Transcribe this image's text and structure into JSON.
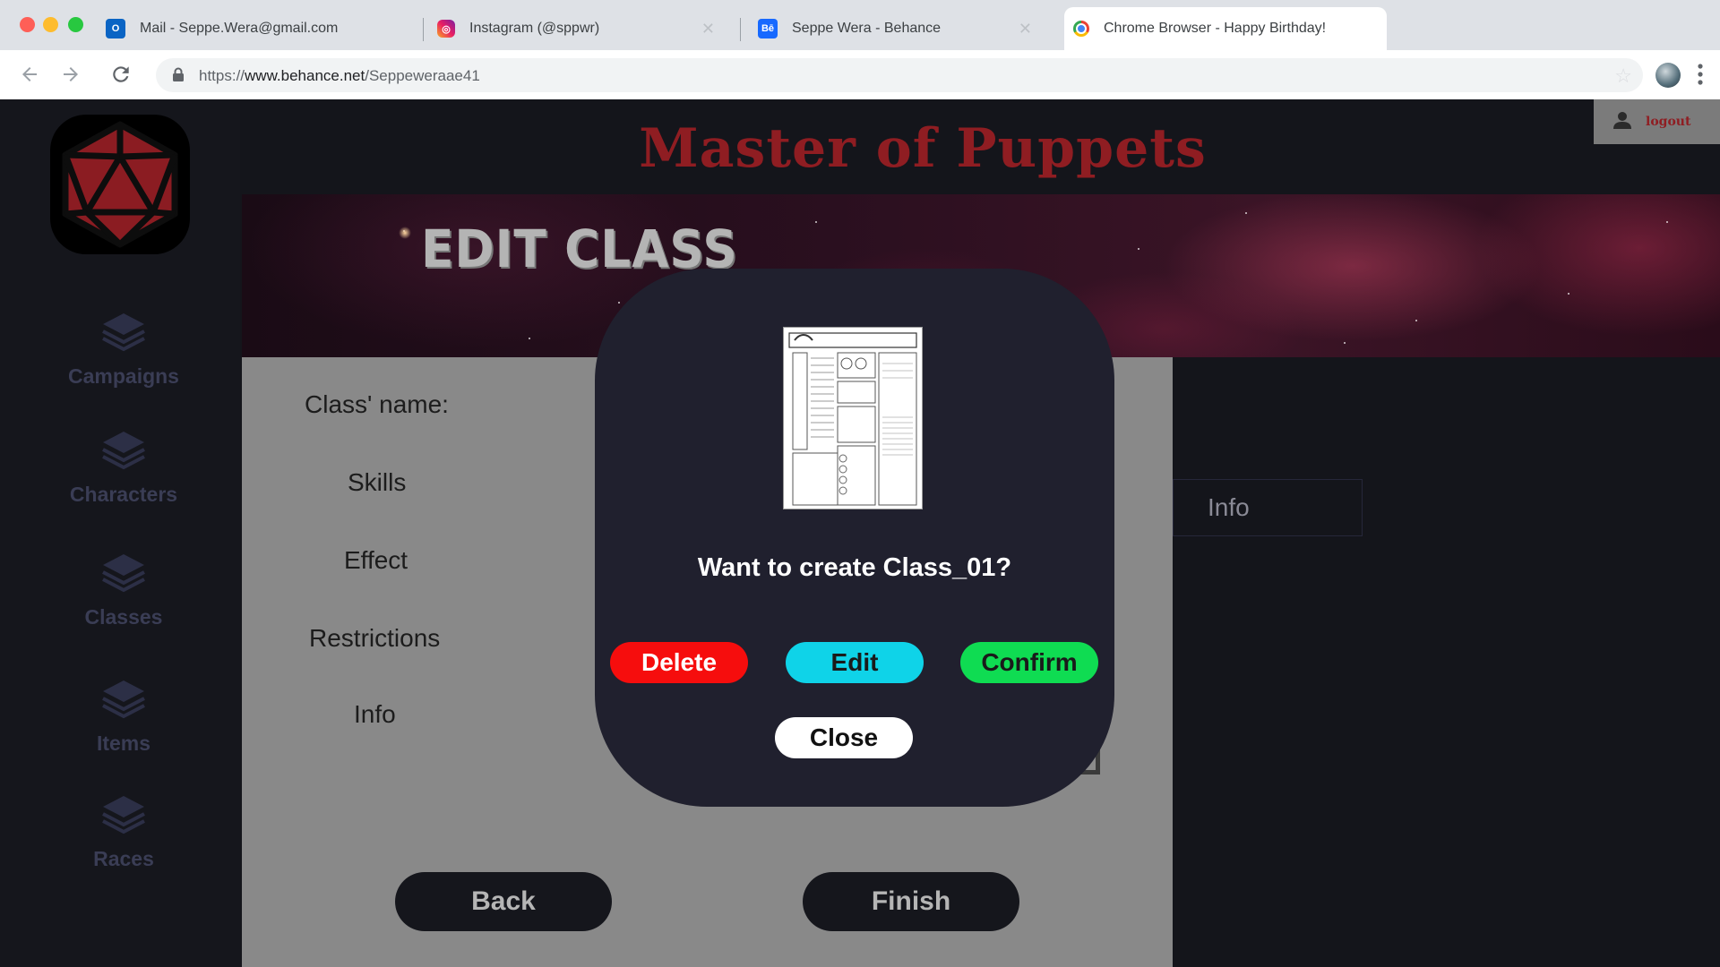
{
  "browser": {
    "tabs": [
      {
        "title": "Mail - Seppe.Wera@gmail.com",
        "icon": "outlook-icon"
      },
      {
        "title": "Instagram (@sppwr)",
        "icon": "instagram-icon"
      },
      {
        "title": "Seppe Wera - Behance",
        "icon": "behance-icon"
      },
      {
        "title": "Chrome Browser - Happy Birthday!",
        "icon": "chrome-icon"
      }
    ],
    "url_prefix": "https://",
    "url_domain": "www.behance.net",
    "url_path": "/Seppeweraae41"
  },
  "app": {
    "title": "Master of Puppets",
    "logout_label": "logout",
    "page_title": "EDIT CLASS",
    "nav": [
      "Campaigns",
      "Characters",
      "Classes",
      "Items",
      "Races"
    ],
    "form": {
      "labels": [
        "Class' name:",
        "Skills",
        "Effect",
        "Restrictions",
        "Info"
      ],
      "back_label": "Back",
      "finish_label": "Finish"
    },
    "side_info_label": "Info",
    "modal": {
      "question": "Want to create Class_01?",
      "delete_label": "Delete",
      "edit_label": "Edit",
      "confirm_label": "Confirm",
      "close_label": "Close"
    },
    "colors": {
      "accent_red": "#8f1d22",
      "delete": "#f60d0d",
      "edit": "#0fd3e8",
      "confirm": "#0fdc52"
    }
  }
}
